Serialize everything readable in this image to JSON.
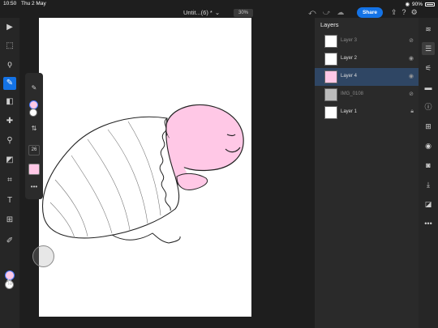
{
  "status_bar": {
    "time": "10:50",
    "date": "Thu 2 May",
    "battery": "90%"
  },
  "document": {
    "title": "Untit...(6) *",
    "zoom": "30%"
  },
  "topbar": {
    "share_label": "Share"
  },
  "left_tools": [
    {
      "icon": "select-arrow-icon",
      "label": "▶"
    },
    {
      "icon": "transform-icon",
      "label": "⬚"
    },
    {
      "icon": "lasso-icon",
      "label": "ϙ"
    },
    {
      "icon": "brush-icon",
      "label": "✎",
      "active": true
    },
    {
      "icon": "eraser-icon",
      "label": "◧"
    },
    {
      "icon": "healing-icon",
      "label": "✚"
    },
    {
      "icon": "clone-stamp-icon",
      "label": "⚲"
    },
    {
      "icon": "paint-bucket-icon",
      "label": "◩"
    },
    {
      "icon": "crop-icon",
      "label": "⌗"
    },
    {
      "icon": "type-icon",
      "label": "T"
    },
    {
      "icon": "place-image-icon",
      "label": "⊞"
    },
    {
      "icon": "eyedropper-icon",
      "label": "✐"
    }
  ],
  "colors": {
    "primary": "#ffc8e6",
    "secondary": "#ffffff",
    "accent": "#1473e6"
  },
  "brush_flyout": {
    "size": "26"
  },
  "layers_panel": {
    "title": "Layers",
    "layers": [
      {
        "name": "Layer 3",
        "visible": false
      },
      {
        "name": "Layer 2",
        "visible": true
      },
      {
        "name": "Layer 4",
        "visible": true,
        "selected": true
      },
      {
        "name": "IMG_0108",
        "visible": false
      },
      {
        "name": "Layer 1",
        "visible": true,
        "locked": true
      }
    ]
  },
  "right_tools": [
    {
      "icon": "layers-icon",
      "label": "≋"
    },
    {
      "icon": "layer-stack-icon",
      "label": "☰"
    },
    {
      "icon": "adjustments-icon",
      "label": "⚟"
    },
    {
      "icon": "comments-icon",
      "label": "▬"
    },
    {
      "icon": "info-icon",
      "label": "ⓘ"
    },
    {
      "icon": "add-layer-icon",
      "label": "⊞"
    },
    {
      "icon": "visibility-icon",
      "label": "◉"
    },
    {
      "icon": "mask-icon",
      "label": "◙"
    },
    {
      "icon": "merge-icon",
      "label": "⤓"
    },
    {
      "icon": "fill-icon",
      "label": "◪"
    },
    {
      "icon": "more-icon",
      "label": "•••"
    }
  ]
}
